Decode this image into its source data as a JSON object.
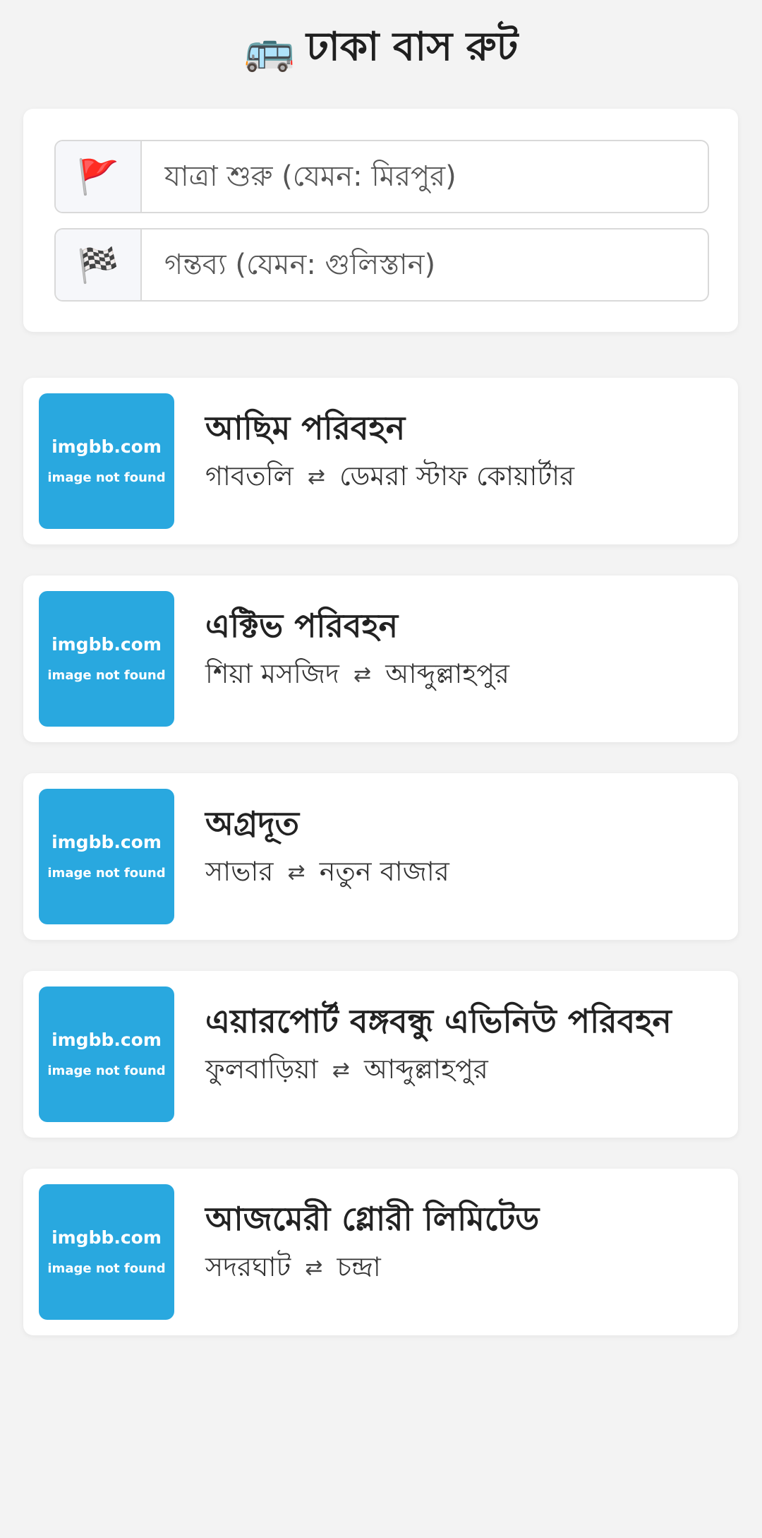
{
  "header": {
    "icon": "🚌",
    "title": "ঢাকা বাস রুট"
  },
  "search": {
    "start": {
      "icon": "🚩",
      "icon_name": "red-flag-icon",
      "placeholder": "যাত্রা শুরু (যেমন: মিরপুর)",
      "value": ""
    },
    "destination": {
      "icon": "🏁",
      "icon_name": "checkered-flag-icon",
      "placeholder": "গন্তব্য (যেমন: গুলিস্তান)",
      "value": ""
    }
  },
  "routes": [
    {
      "image_main": "imgbb.com",
      "image_sub": "image not found",
      "name": "আছিম পরিবহন",
      "from": "গাবতলি",
      "arrow": "⇄",
      "to": "ডেমরা স্টাফ কোয়ার্টার"
    },
    {
      "image_main": "imgbb.com",
      "image_sub": "image not found",
      "name": "এক্টিভ পরিবহন",
      "from": "শিয়া মসজিদ",
      "arrow": "⇄",
      "to": "আব্দুল্লাহপুর"
    },
    {
      "image_main": "imgbb.com",
      "image_sub": "image not found",
      "name": "অগ্রদূত",
      "from": "সাভার",
      "arrow": "⇄",
      "to": "নতুন বাজার"
    },
    {
      "image_main": "imgbb.com",
      "image_sub": "image not found",
      "name": "এয়ারপোর্ট বঙ্গবন্ধু এভিনিউ পরিবহন",
      "from": "ফুলবাড়িয়া",
      "arrow": "⇄",
      "to": "আব্দুল্লাহপুর"
    },
    {
      "image_main": "imgbb.com",
      "image_sub": "image not found",
      "name": "আজমেরী গ্লোরী লিমিটেড",
      "from": "সদরঘাট",
      "arrow": "⇄",
      "to": "চন্দ্রা"
    }
  ],
  "colors": {
    "background": "#f3f3f3",
    "card": "#ffffff",
    "thumbnail": "#29a8df",
    "text": "#222222"
  }
}
